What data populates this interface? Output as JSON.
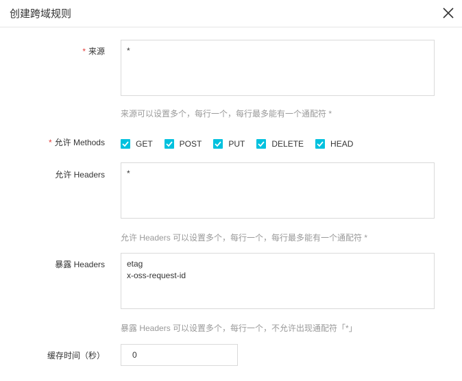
{
  "dialog": {
    "title": "创建跨域规则"
  },
  "form": {
    "origin": {
      "required_mark": "*",
      "label": "来源",
      "value": "*",
      "hint": "来源可以设置多个，每行一个，每行最多能有一个通配符 *"
    },
    "methods": {
      "required_mark": "*",
      "label": "允许 Methods",
      "options": [
        {
          "label": "GET",
          "checked": true
        },
        {
          "label": "POST",
          "checked": true
        },
        {
          "label": "PUT",
          "checked": true
        },
        {
          "label": "DELETE",
          "checked": true
        },
        {
          "label": "HEAD",
          "checked": true
        }
      ]
    },
    "allow_headers": {
      "label": "允许 Headers",
      "value": "*",
      "hint": "允许 Headers 可以设置多个，每行一个，每行最多能有一个通配符 *"
    },
    "expose_headers": {
      "label": "暴露 Headers",
      "value": "etag\nx-oss-request-id",
      "hint": "暴露 Headers 可以设置多个，每行一个，不允许出现通配符「*」"
    },
    "cache_time": {
      "label": "缓存时间（秒）",
      "value": "0"
    }
  },
  "colors": {
    "accent": "#00c1de",
    "required": "#e23c39",
    "hint": "#999999",
    "border": "#d9d9d9"
  }
}
